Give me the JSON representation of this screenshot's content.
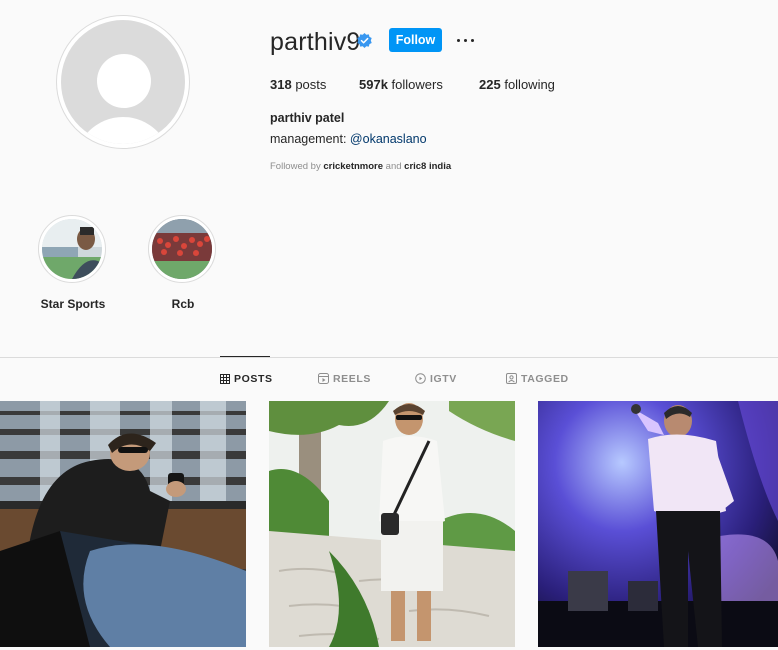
{
  "profile": {
    "username": "parthiv9",
    "follow_label": "Follow",
    "posts_count": "318",
    "posts_label": "posts",
    "followers_count": "597k",
    "followers_label": "followers",
    "following_count": "225",
    "following_label": "following",
    "full_name": "parthiv patel",
    "bio_prefix": "management: ",
    "bio_mention": "@okanaslano",
    "followed_by_prefix": "Followed by ",
    "followed_by_user1": "cricketnmore",
    "followed_by_and": " and ",
    "followed_by_user2": "cric8 india"
  },
  "highlights": [
    {
      "label": "Star Sports"
    },
    {
      "label": "Rcb"
    }
  ],
  "tabs": [
    {
      "label": "POSTS",
      "icon": "grid-icon"
    },
    {
      "label": "REELS",
      "icon": "reels-icon"
    },
    {
      "label": "IGTV",
      "icon": "igtv-icon"
    },
    {
      "label": "TAGGED",
      "icon": "tagged-icon"
    }
  ],
  "colors": {
    "accent": "#0095f6",
    "verified": "#3897f0",
    "mention": "#00376b",
    "muted": "#8e8e8e"
  }
}
